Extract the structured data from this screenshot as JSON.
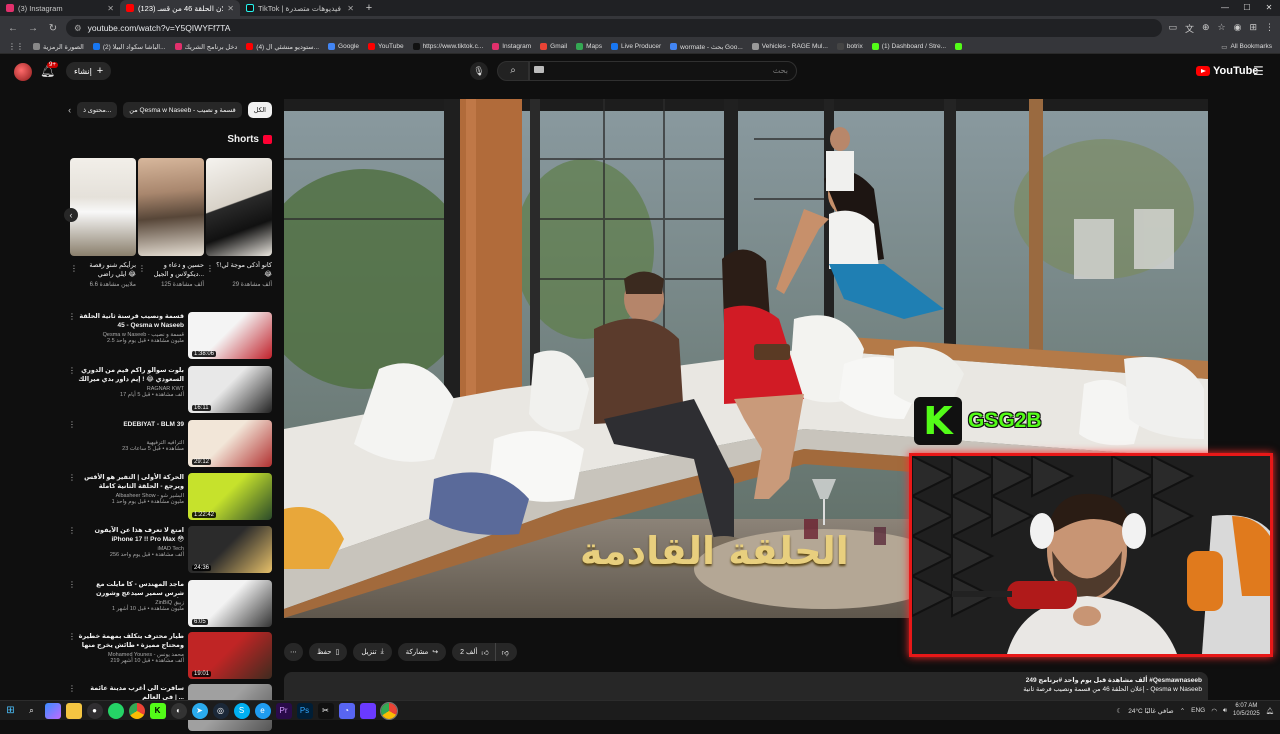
{
  "browser": {
    "tabs": [
      {
        "title": "(3) Instagram",
        "color": "#e1306c",
        "active": false
      },
      {
        "title": "(123) إعلان الحلقة 46 من قسـ...",
        "color": "#ff0000",
        "active": true
      },
      {
        "title": "TikTok | شاهد فيديوهات متصدرة",
        "color": "#111111",
        "active": false
      }
    ],
    "new_tab": "+",
    "url": "youtube.com/watch?v=Y5QIWYFf7TA",
    "bookmarks": [
      {
        "label": "الصورة الرمزية",
        "color": "#888888"
      },
      {
        "label": "(2) الباشا سكواد البيلا...",
        "color": "#1877f2"
      },
      {
        "label": "دخل برنامج الشريك",
        "color": "#e1306c"
      },
      {
        "label": "(4) ستوديو منشئي ال...",
        "color": "#ff0000"
      },
      {
        "label": "Google",
        "color": "#4285f4"
      },
      {
        "label": "YouTube",
        "color": "#ff0000"
      },
      {
        "label": "https://www.tiktok.c...",
        "color": "#111111"
      },
      {
        "label": "Instagram",
        "color": "#e1306c"
      },
      {
        "label": "Gmail",
        "color": "#ea4335"
      },
      {
        "label": "Maps",
        "color": "#34a853"
      },
      {
        "label": "Live Producer",
        "color": "#1877f2"
      },
      {
        "label": "wormate - بحث Goo...",
        "color": "#4285f4"
      },
      {
        "label": "Vehicles - RAGE Mul...",
        "color": "#999999"
      },
      {
        "label": "botrix",
        "color": "#444444"
      },
      {
        "label": "(1) Dashboard / Stre...",
        "color": "#53fc18"
      },
      {
        "label": "",
        "color": "#53fc18"
      }
    ],
    "all_bookmarks": "All Bookmarks"
  },
  "header": {
    "create_label": "إنشاء",
    "notification_count": "9+",
    "search_placeholder": "بحث",
    "logo_text": "YouTube"
  },
  "sidebar": {
    "chips": [
      "الكل",
      "من Qesma w Naseeb - قسمة و نصيب",
      "محتوى ذ..."
    ],
    "shorts_title": "Shorts",
    "shorts": [
      {
        "title": "كانو أذكى موجة لي!؟ 😂",
        "views": "29 ألف مشاهدة",
        "color1": "#e9e6e0",
        "color2": "#222222"
      },
      {
        "title": "حسين و دعاء و ديكولاس و الجيل...",
        "views": "125 ألف مشاهدة",
        "color1": "#c9a68d",
        "color2": "#5b4a3c"
      },
      {
        "title": "برأيكم شنو رقصة ايلي راضي 😂",
        "views": "6.6 ملايين مشاهدة",
        "color1": "#e8e5df",
        "color2": "#8a7f6c"
      }
    ],
    "videos": [
      {
        "title": "قسمة ونصيب قرسنة ثانية الحلقة 45 - Qesma w Naseeb",
        "channel": "Qesma w Naseeb - قسمة و نصيب",
        "info": "2.5 مليون مشاهدة • قبل يوم واحد",
        "duration": "1:38:06",
        "color1": "#f4f4f4",
        "color2": "#c0202a"
      },
      {
        "title": "بلوت سوالو راكم فيم من الدوري السعودي 😂 ! إيم داور بدي ميرالك",
        "channel": "RAGNAR KWT",
        "info": "17 ألف مشاهدة • قبل 5 أيام",
        "duration": "16:11",
        "color1": "#e8e8e8",
        "color2": "#222222"
      },
      {
        "title": "EDEBIYAT - BLM 39",
        "channel": "الترافيه الترفيهية",
        "info": "23 مشاهدة • قبل 5 ساعات",
        "duration": "29:12",
        "color1": "#f2e6d8",
        "color2": "#b13030"
      },
      {
        "title": "الحركة الأولى | التفير هو الأقس ويرجع - الحلقة الثانية كاملة",
        "channel": "Albasheer Show - البشير شو",
        "info": "1 مليون مشاهدة • قبل يوم واحد",
        "duration": "1:22:42",
        "color1": "#c6e22c",
        "color2": "#2a4a2a"
      },
      {
        "title": "امتع لا تعرف هذا عن الآيفون iPhone 17 !! Pro Max 😳",
        "channel": "iMAD Tech",
        "info": "256 ألف مشاهدة • قبل يوم واحد",
        "duration": "24:36",
        "color1": "#2b2b2b",
        "color2": "#e7c16a"
      },
      {
        "title": "ماجد المهندس - كا مايلت مع شرس سمير سيدعج وشورن الأغاني",
        "channel": "ZinBiQ زبيق",
        "info": "1 مليون مشاهدة • قبل 10 أشهر",
        "duration": "6:05",
        "color1": "#f2f2f2",
        "color2": "#333333"
      },
      {
        "title": "طيار محترف يتكلف بمهمة خطيرة ومحتاج مميزة • طائش يخرج منها حي | ملخص فيلم ...",
        "channel": "Mohamed Younes - محمد يونس",
        "info": "219 ألف مشاهدة • قبل 10 أشهر",
        "duration": "19:01",
        "color1": "#c02525",
        "color2": "#3e2b1f"
      },
      {
        "title": "سافرت الى أغرب مدينة عائمة في العالم | ...",
        "channel": "",
        "info": "",
        "duration": "",
        "color1": "#a0a0a0",
        "color2": "#555555"
      }
    ]
  },
  "player": {
    "subtitle_overlay": "الحلقة القادمة",
    "streamer_logo_letter": "K",
    "streamer_name": "GSG2B"
  },
  "actions": {
    "more": "⋯",
    "save": "حفظ",
    "download": "تنزيل",
    "share": "مشاركة",
    "likes": "2 ألف"
  },
  "description": {
    "views_line": "249 ألف مشاهدة  قبل يوم واحد  #برنامج #Qesmawnaseeb",
    "title_line": "إعلان الحلقة 46 من قسمة ونصيب فرصة ثانية - Qesma w Naseeb"
  },
  "taskbar": {
    "weather": "24°C صافي غالبًا",
    "time": "6:07 AM",
    "date": "10/5/2025",
    "lang": "ENG"
  }
}
